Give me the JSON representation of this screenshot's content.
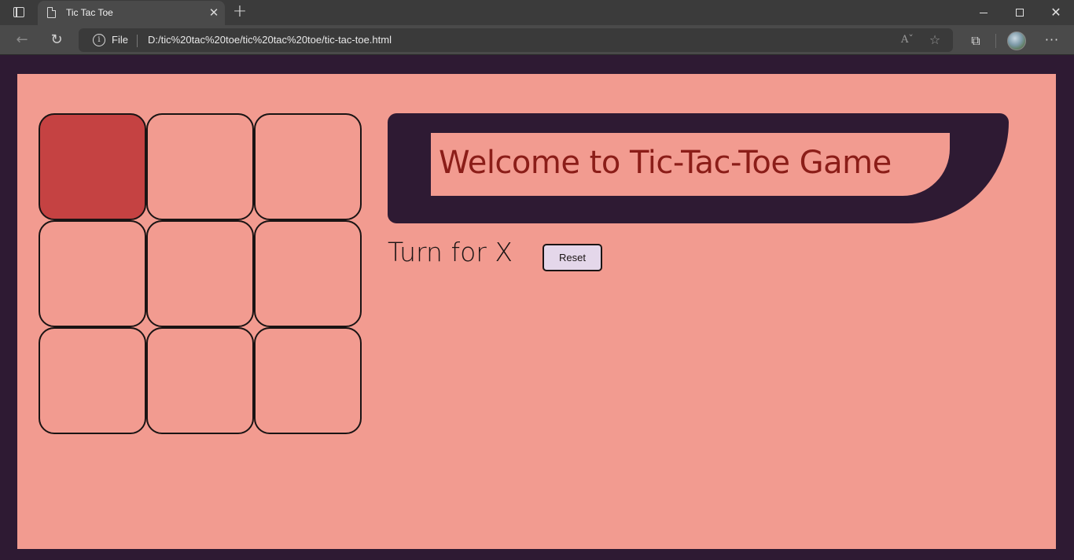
{
  "browser": {
    "tab_title": "Tic Tac Toe",
    "tab_close_glyph": "✕",
    "new_tab_glyph": "+",
    "address_prefix": "File",
    "url": "D:/tic%20tac%20toe/tic%20tac%20toe/tic-tac-toe.html",
    "window_controls": [
      "minimize",
      "restore",
      "close"
    ]
  },
  "page": {
    "title": "Welcome to Tic-Tac-Toe Game",
    "turn_text": "Turn for X",
    "reset_label": "Reset",
    "board": {
      "rows": 3,
      "cols": 3,
      "cells": [
        "",
        "",
        "",
        "",
        "",
        "",
        "",
        "",
        ""
      ],
      "highlighted_cell": 0
    }
  },
  "colors": {
    "page_border": "#2e1a33",
    "game_bg": "#f29b90",
    "active_cell": "#c54242",
    "title_text": "#8b1d18",
    "reset_bg": "#e4d7ea"
  }
}
